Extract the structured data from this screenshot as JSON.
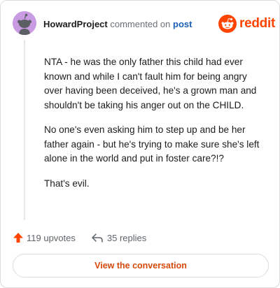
{
  "comment": {
    "username": "HowardProject",
    "action_text": "commented on",
    "post_link": "post",
    "paragraphs": [
      "NTA - he was the only father this child had ever known and while I can't fault him for being angry over having been deceived, he's a grown man and shouldn't be taking his anger out on the CHILD.",
      "No one's even asking him to step up and be her father again - but he's trying to make sure she's left alone in the world and put in foster care?!?",
      "That's evil."
    ],
    "upvotes_label": "119 upvotes",
    "replies_label": "35 replies"
  },
  "brand": {
    "wordmark": "reddit",
    "color": "#ff4500"
  },
  "cta": {
    "label": "View the conversation"
  },
  "icons": {
    "avatar": "snoo-avatar-icon",
    "logo": "reddit-snoo-icon",
    "upvote": "upvote-arrow-icon",
    "reply": "reply-arrow-icon"
  },
  "colors": {
    "avatar_bg": "#c99be3",
    "link": "#1a5fb4",
    "upvote": "#ff4500",
    "cta_text": "#d4490b"
  }
}
